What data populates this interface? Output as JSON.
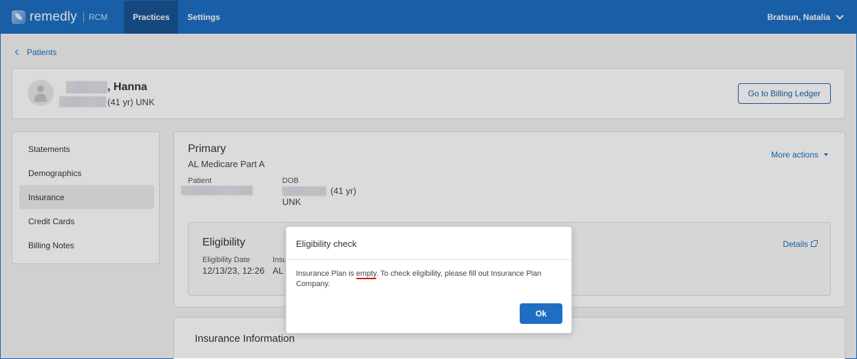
{
  "header": {
    "brand_name": "remedly",
    "brand_sub": "RCM",
    "tabs": [
      {
        "label": "Practices",
        "active": true
      },
      {
        "label": "Settings",
        "active": false
      }
    ],
    "user_name": "Bratsun, Natalia"
  },
  "breadcrumb": {
    "back_label": "Patients"
  },
  "patient": {
    "name_suffix": ", Hanna",
    "sub_suffix": "(41 yr) UNK",
    "billing_button": "Go to Billing Ledger"
  },
  "sidebar": {
    "items": [
      {
        "label": "Statements",
        "active": false
      },
      {
        "label": "Demographics",
        "active": false
      },
      {
        "label": "Insurance",
        "active": true
      },
      {
        "label": "Credit Cards",
        "active": false
      },
      {
        "label": "Billing Notes",
        "active": false
      }
    ]
  },
  "insurance": {
    "title": "Primary",
    "plan": "AL Medicare Part A",
    "more_actions": "More actions",
    "patient_label": "Patient",
    "dob_label": "DOB",
    "dob_suffix": "(41 yr)",
    "gender": "UNK"
  },
  "eligibility": {
    "title": "Eligibility",
    "date_label": "Eligibility Date",
    "date_value": "12/13/23, 12:26",
    "insurance_label": "Insu",
    "insurance_value": "AL",
    "details_label": "Details"
  },
  "insurance_info": {
    "title": "Insurance Information"
  },
  "modal": {
    "title": "Eligibility check",
    "body_pre": "Insurance Plan is ",
    "body_flag": "empty",
    "body_post": ". To check eligibility, please fill out Insurance Plan Company.",
    "ok_label": "Ok"
  },
  "colors": {
    "brand": "#1e6fc4",
    "link": "#1a6fc4",
    "active_tab": "#1a5496"
  }
}
